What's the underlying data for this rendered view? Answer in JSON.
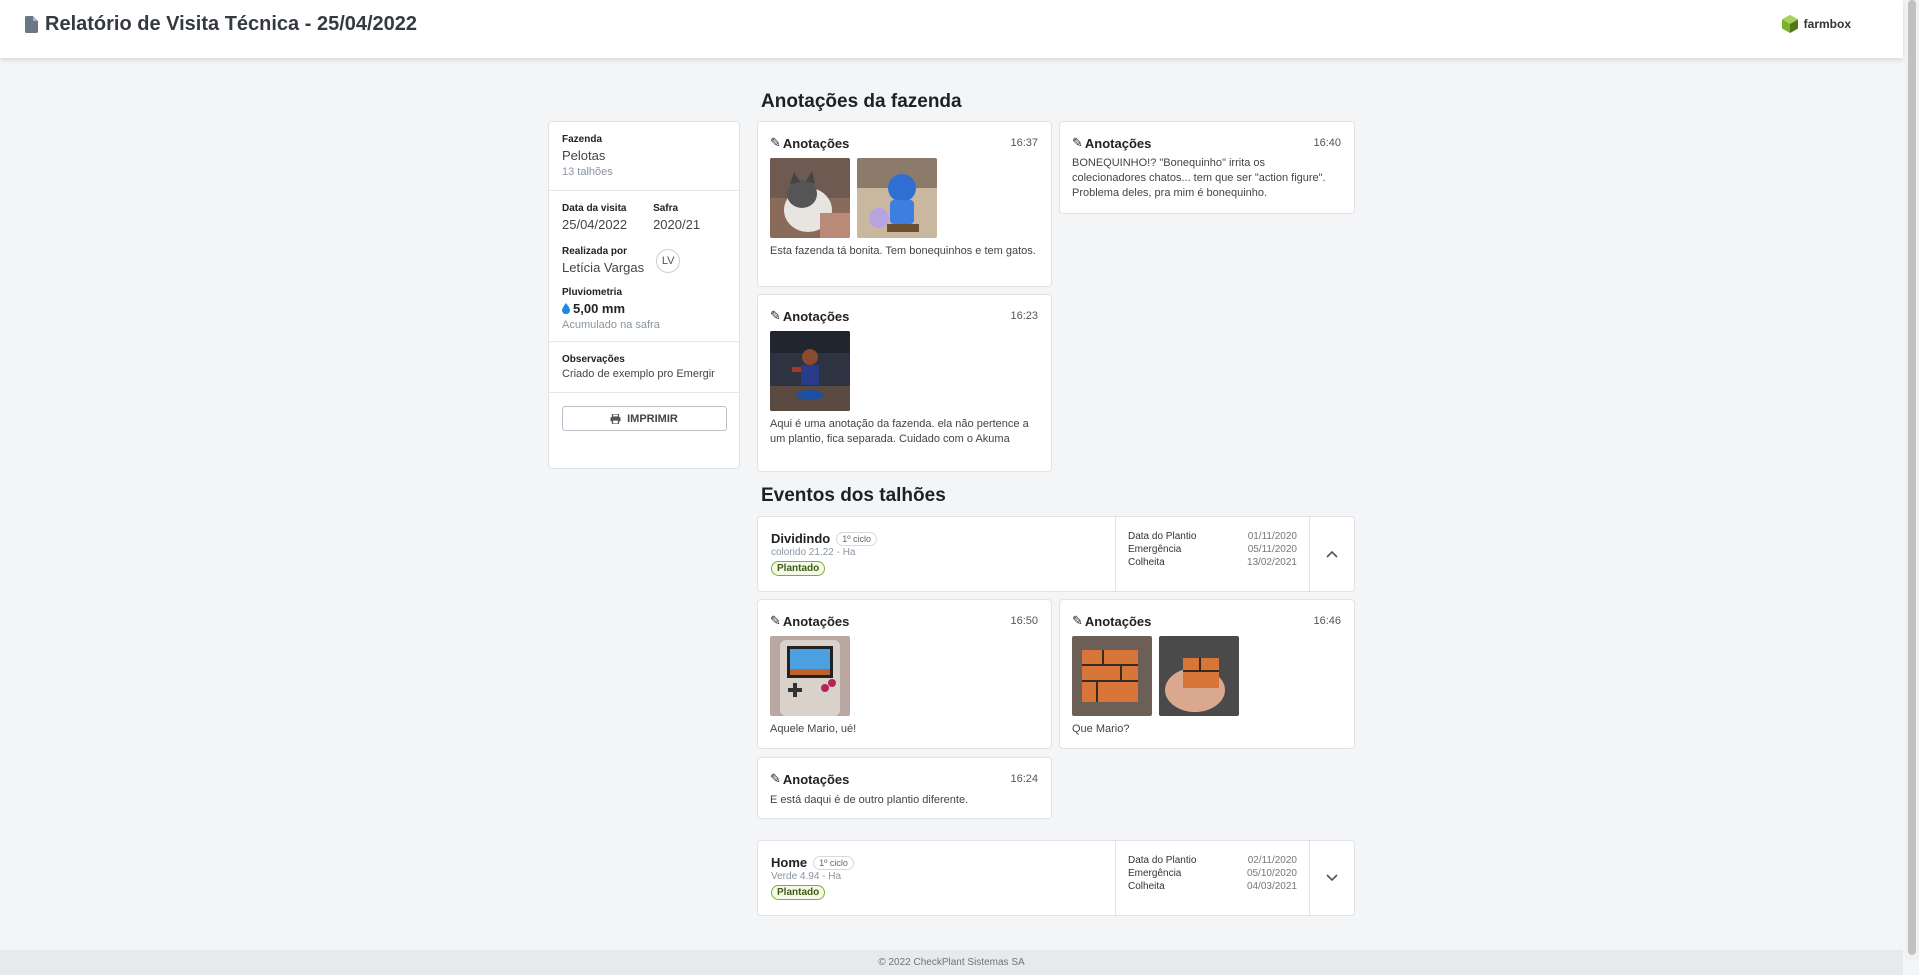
{
  "header": {
    "title": "Relatório de Visita Técnica - 25/04/2022",
    "brand": "farmbox"
  },
  "summary": {
    "farm_label": "Fazenda",
    "farm_name": "Pelotas",
    "farm_plots": "13 talhões",
    "visit_date_label": "Data da visita",
    "visit_date": "25/04/2022",
    "season_label": "Safra",
    "season": "2020/21",
    "performed_by_label": "Realizada por",
    "performed_by": "Letícia Vargas",
    "initials": "LV",
    "rain_label": "Pluviometria",
    "rain_value": "5,00 mm",
    "rain_sub": "Acumulado na safra",
    "notes_label": "Observações",
    "notes": "Criado de exemplo pro Emergir",
    "print_label": "IMPRIMIR"
  },
  "farm_notes_title": "Anotações da fazenda",
  "farm_notes": [
    {
      "title": "Anotações",
      "time": "16:37",
      "text": "Esta fazenda tá bonita. Tem bonequinhos e tem gatos."
    },
    {
      "title": "Anotações",
      "time": "16:40",
      "text": "BONEQUINHO!? \"Bonequinho\" irrita os colecionadores chatos... tem que ser \"action figure\". Problema deles, pra mim é bonequinho."
    },
    {
      "title": "Anotações",
      "time": "16:23",
      "text": "Aqui é uma anotação da fazenda. ela não pertence a um plantio, fica separada. Cuidado com o Akuma"
    }
  ],
  "events_title": "Eventos dos talhões",
  "plots": [
    {
      "name": "Dividindo",
      "cycle": "1º ciclo",
      "sub": "colorido 21.22 - Ha",
      "status": "Plantado",
      "planting_label": "Data do Plantio",
      "planting": "01/11/2020",
      "emergence_label": "Emergência",
      "emergence": "05/11/2020",
      "harvest_label": "Colheita",
      "harvest": "13/02/2021",
      "toggle": "chevron-up-icon"
    },
    {
      "name": "Home",
      "cycle": "1º ciclo",
      "sub": "Verde 4.94 - Ha",
      "status": "Plantado",
      "planting_label": "Data do Plantio",
      "planting": "02/11/2020",
      "emergence_label": "Emergência",
      "emergence": "05/10/2020",
      "harvest_label": "Colheita",
      "harvest": "04/03/2021",
      "toggle": "chevron-down-icon"
    }
  ],
  "plot_notes": [
    {
      "title": "Anotações",
      "time": "16:50",
      "text": "Aquele Mario, ué!"
    },
    {
      "title": "Anotações",
      "time": "16:46",
      "text": "Que Mario?"
    },
    {
      "title": "Anotações",
      "time": "16:24",
      "text": "E está daqui é de outro plantio diferente."
    }
  ],
  "footer": "© 2022 CheckPlant Sistemas SA",
  "colors": {
    "accent_green": "#7bb02b",
    "background": "#f3f5f7",
    "rain_blue": "#1e88e5"
  }
}
